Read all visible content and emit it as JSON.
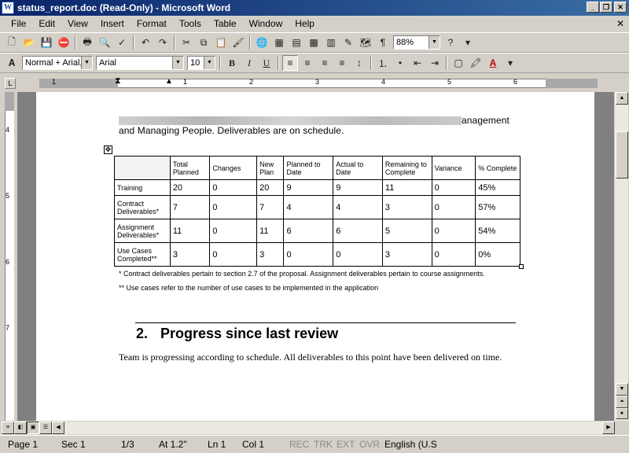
{
  "window": {
    "title": "status_report.doc (Read-Only) - Microsoft Word",
    "app_icon": "W"
  },
  "menu": {
    "items": [
      "File",
      "Edit",
      "View",
      "Insert",
      "Format",
      "Tools",
      "Table",
      "Window",
      "Help"
    ]
  },
  "toolbar": {
    "zoom": "88%",
    "style": "Normal + Arial,",
    "font": "Arial",
    "size": "10"
  },
  "ruler": {
    "h_numbers": [
      "1",
      "1",
      "2",
      "3",
      "4",
      "5",
      "6"
    ],
    "v_numbers": [
      "4",
      "5",
      "6",
      "7"
    ]
  },
  "document": {
    "intro_tail": "anagement",
    "intro_line2": "and Managing People. Deliverables are on schedule.",
    "table": {
      "headers": [
        "",
        "Total Planned",
        "Changes",
        "New Plan",
        "Planned to Date",
        "Actual to Date",
        "Remaining to Complete",
        "Variance",
        "% Complete"
      ],
      "rows": [
        {
          "label": "Training",
          "values": [
            "20",
            "0",
            "20",
            "9",
            "9",
            "11",
            "0",
            "45%"
          ]
        },
        {
          "label": "Contract Deliverables*",
          "values": [
            "7",
            "0",
            "7",
            "4",
            "4",
            "3",
            "0",
            "57%"
          ]
        },
        {
          "label": "Assignment Deliverables*",
          "values": [
            "11",
            "0",
            "11",
            "6",
            "6",
            "5",
            "0",
            "54%"
          ]
        },
        {
          "label": "Use Cases Completed**",
          "values": [
            "3",
            "0",
            "3",
            "0",
            "0",
            "3",
            "0",
            "0%"
          ]
        }
      ]
    },
    "footnote1": "* Contract deliverables pertain to section 2.7 of the proposal. Assignment deliverables pertain to course assignments.",
    "footnote2": "** Use cases refer to the number of use cases to be implemented in the application",
    "heading_number": "2.",
    "heading_text": "Progress since last review",
    "body": "Team is progressing according to schedule. All deliverables to this point have been delivered on time."
  },
  "status": {
    "page": "Page 1",
    "sec": "Sec 1",
    "pages": "1/3",
    "at": "At 1.2\"",
    "ln": "Ln 1",
    "col": "Col 1",
    "rec": "REC",
    "trk": "TRK",
    "ext": "EXT",
    "ovr": "OVR",
    "lang": "English (U.S"
  }
}
